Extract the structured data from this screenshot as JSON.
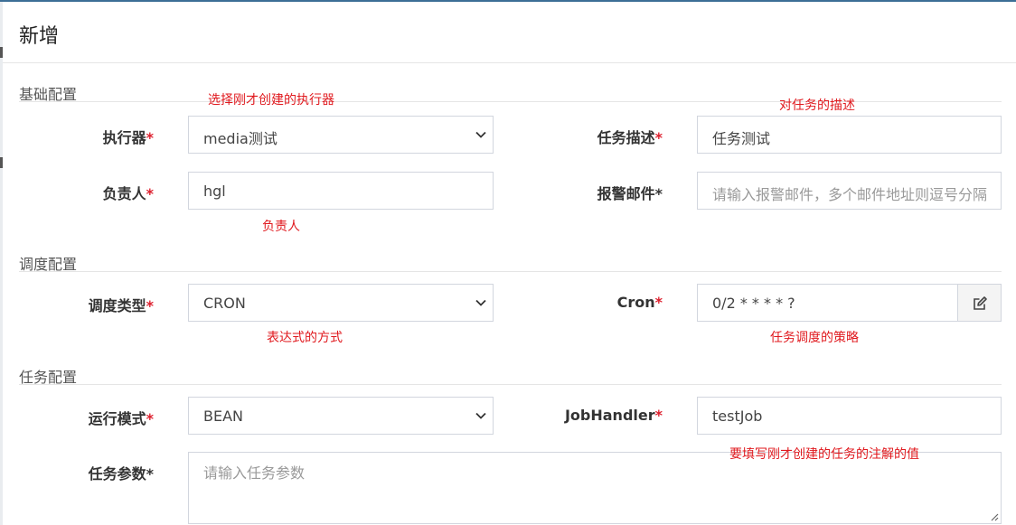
{
  "dialog": {
    "title": "新增"
  },
  "sections": {
    "basic": "基础配置",
    "schedule": "调度配置",
    "task": "任务配置"
  },
  "fields": {
    "executor": {
      "label": "执行器",
      "value": "media测试"
    },
    "job_desc": {
      "label": "任务描述",
      "value": "任务测试"
    },
    "author": {
      "label": "负责人",
      "value": "hgl"
    },
    "alarm_email": {
      "label": "报警邮件",
      "placeholder": "请输入报警邮件，多个邮件地址则逗号分隔"
    },
    "schedule_type": {
      "label": "调度类型",
      "value": "CRON"
    },
    "cron": {
      "label": "Cron",
      "value": "0/2 * * * * ?"
    },
    "run_mode": {
      "label": "运行模式",
      "value": "BEAN"
    },
    "job_handler": {
      "label": "JobHandler",
      "value": "testJob"
    },
    "job_param": {
      "label": "任务参数",
      "placeholder": "请输入任务参数"
    }
  },
  "required_mark": "*",
  "annotations": {
    "executor_note": "选择刚才创建的执行器",
    "desc_note": "对任务的描述",
    "author_note": "负责人",
    "schedule_type_note": "表达式的方式",
    "cron_note": "任务调度的策略",
    "handler_note": "要填写刚才创建的任务的注解的值"
  },
  "icons": {
    "select_arrow": "chevron-down-icon",
    "cron_edit": "edit-icon",
    "resize": "resize-grip-icon"
  },
  "colors": {
    "annotation": "#e0191e",
    "required": "#dd1e2c",
    "border": "#d2d6de",
    "window_accent": "#3c6e96"
  }
}
